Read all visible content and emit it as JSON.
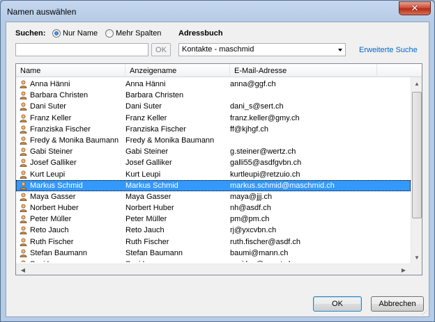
{
  "window": {
    "title": "Namen auswählen",
    "close_symbol": "✕"
  },
  "search": {
    "label": "Suchen:",
    "radio_name_only": "Nur Name",
    "radio_more_columns": "Mehr Spalten",
    "input_value": "",
    "ok_label": "OK"
  },
  "addressbook": {
    "label": "Adressbuch",
    "selected": "Kontakte - maschmid",
    "advanced_link": "Erweiterte Suche"
  },
  "columns": [
    "Name",
    "Anzeigename",
    "E-Mail-Adresse"
  ],
  "rows": [
    {
      "name": "Anna Hänni",
      "display": "Anna Hänni",
      "email": "anna@ggf.ch"
    },
    {
      "name": "Barbara Christen",
      "display": "Barbara Christen",
      "email": ""
    },
    {
      "name": "Dani Suter",
      "display": "Dani Suter",
      "email": "dani_s@sert.ch"
    },
    {
      "name": "Franz Keller",
      "display": "Franz Keller",
      "email": "franz.keller@gmy.ch"
    },
    {
      "name": "Franziska Fischer",
      "display": "Franziska Fischer",
      "email": "ff@kjhgf.ch"
    },
    {
      "name": "Fredy & Monika Baumann",
      "display": "Fredy & Monika Baumann",
      "email": ""
    },
    {
      "name": "Gabi Steiner",
      "display": "Gabi Steiner",
      "email": "g.steiner@wertz.ch"
    },
    {
      "name": "Josef Galliker",
      "display": "Josef Galliker",
      "email": "galli55@asdfgvbn.ch"
    },
    {
      "name": "Kurt Leupi",
      "display": "Kurt Leupi",
      "email": "kurtleupi@retzuio.ch"
    },
    {
      "name": "Markus Schmid",
      "display": "Markus Schmid",
      "email": "markus.schmid@maschmid.ch",
      "selected": true
    },
    {
      "name": "Maya Gasser",
      "display": "Maya Gasser",
      "email": "maya@jjj.ch"
    },
    {
      "name": "Norbert Huber",
      "display": "Norbert Huber",
      "email": "nh@asdf.ch"
    },
    {
      "name": "Peter Müller",
      "display": "Peter Müller",
      "email": "pm@pm.ch"
    },
    {
      "name": "Reto Jauch",
      "display": "Reto Jauch",
      "email": "rj@yxcvbn.ch"
    },
    {
      "name": "Ruth Fischer",
      "display": "Ruth Fischer",
      "email": "ruth.fischer@asdf.ch"
    },
    {
      "name": "Stefan Baumann",
      "display": "Stefan Baumann",
      "email": "baumi@mann.ch"
    },
    {
      "name": "Susi Lou",
      "display": "Susi Lou",
      "email": "susi.lou@qwert.ch"
    }
  ],
  "buttons": {
    "ok": "OK",
    "cancel": "Abbrechen"
  },
  "colors": {
    "selection": "#3399ff",
    "link": "#0066cc"
  }
}
